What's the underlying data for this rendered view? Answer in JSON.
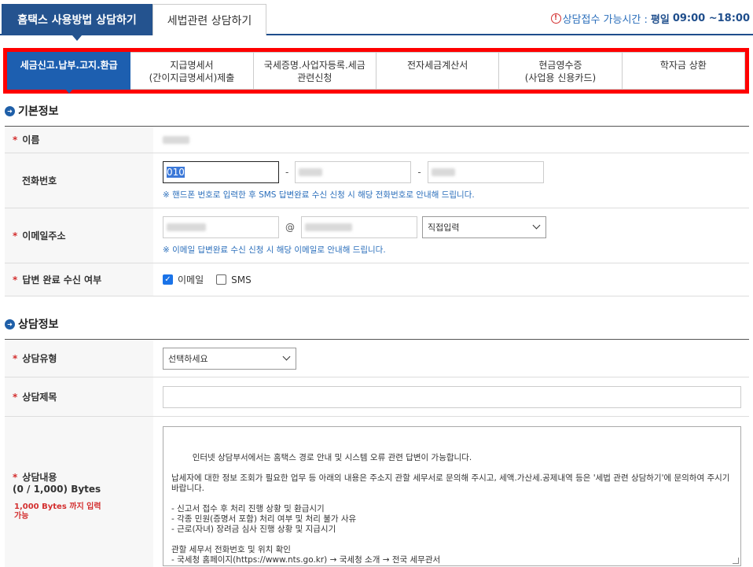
{
  "top_tabs": {
    "active": "홈택스 사용방법 상담하기",
    "inactive": "세법관련 상담하기"
  },
  "hours": {
    "label": "상담접수 가능시간 :",
    "day": "평일",
    "time": "09:00 ~18:00"
  },
  "sub_tabs": [
    {
      "line1": "세금신고.납부.고지.환급",
      "line2": ""
    },
    {
      "line1": "지급명세서",
      "line2": "(간이지급명세서)제출"
    },
    {
      "line1": "국세증명.사업자등록.세금",
      "line2": "관련신청"
    },
    {
      "line1": "전자세금계산서",
      "line2": ""
    },
    {
      "line1": "현금영수증",
      "line2": "(사업용 신용카드)"
    },
    {
      "line1": "학자금 상환",
      "line2": ""
    }
  ],
  "basic": {
    "title": "기본정보",
    "name_label": "이름",
    "phone_label": "전화번호",
    "phone_prefix": "010",
    "phone_sep": "-",
    "phone_hint": "※ 핸드폰 번호로 입력한 후 SMS 답변완료 수신 신청 시 해당 전화번호로 안내해 드립니다.",
    "email_label": "이메일주소",
    "email_at": "@",
    "email_domain_select": "직접입력",
    "email_hint": "※ 이메일 답변완료 수신 신청 시 해당 이메일로 안내해 드립니다.",
    "notify_label": "답변 완료 수신 여부",
    "notify_email": "이메일",
    "notify_sms": "SMS"
  },
  "consult": {
    "title": "상담정보",
    "type_label": "상담유형",
    "type_select": "선택하세요",
    "subject_label": "상담제목",
    "content_label": "상담내용",
    "content_bytes": "(0 / 1,000) Bytes",
    "content_note_1": "1,000 Bytes 까지 입력",
    "content_note_2": "가능",
    "content_text": "인터넷 상담부서에서는 홈택스 경로 안내 및 시스템 오류 관련 답변이 가능합니다.\n\n납세자에 대한 정보 조회가 필요한 업무 등 아래의 내용은 주소지 관할 세무서로 문의해 주시고, 세액.가산세.공제내역 등은 '세법 관련 상담하기'에 문의하여 주시기 바랍니다.\n\n- 신고서 접수 후 처리 진행 상황 및 환급시기\n- 각종 민원(증명서 포함) 처리 여부 및 처리 불가 사유\n- 근로(자녀) 장려금 심사 진행 상황 및 지급시기\n\n관할 세무서 전화번호 및 위치 확인\n- 국세청 홈페이지(https://www.nts.go.kr) → 국세청 소개 → 전국 세무관서"
  },
  "colors": {
    "primary": "#24538f",
    "active_subtab": "#1d5fb0",
    "highlight_frame": "#ff0000",
    "required": "#d32f2f"
  }
}
